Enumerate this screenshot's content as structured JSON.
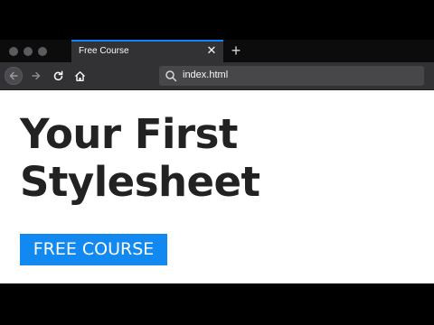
{
  "browser": {
    "tab": {
      "title": "Free Course"
    },
    "url": "index.html",
    "icons": [
      "close-icon",
      "plus-icon",
      "back-arrow-icon",
      "forward-arrow-icon",
      "reload-icon",
      "home-icon",
      "search-icon"
    ]
  },
  "page": {
    "headline": [
      "Your First",
      "Stylesheet"
    ],
    "cta_label": "FREE COURSE"
  },
  "colors": {
    "accent": "#1189f0",
    "tab_highlight": "#0a84ff",
    "heading": "#222222",
    "chrome": "#323234"
  }
}
